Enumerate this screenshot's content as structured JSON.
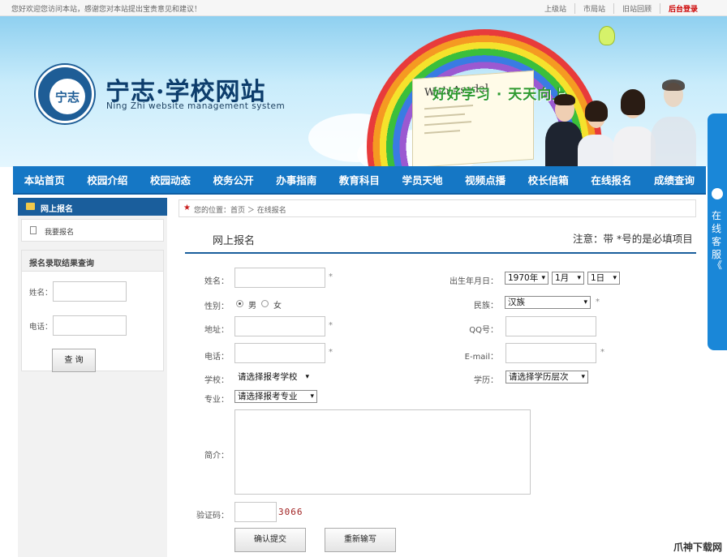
{
  "topbar": {
    "welcome": "您好欢迎您访问本站，感谢您对本站提出宝贵意见和建议！",
    "links": [
      "上级站",
      "市局站",
      "旧站回顾",
      "后台登录"
    ]
  },
  "banner": {
    "logo_text": "宁志",
    "title": "宁志·学校网站",
    "subtitle": "Ning Zhi website management system",
    "slogan": "好好学习 · 天天向上",
    "book_text": "With Asadal"
  },
  "nav": [
    "本站首页",
    "校园介绍",
    "校园动态",
    "校务公开",
    "办事指南",
    "教育科目",
    "学员天地",
    "视频点播",
    "校长信箱",
    "在线报名",
    "成绩查询"
  ],
  "service": {
    "label": "在线客服",
    "chevron": "《"
  },
  "sidebar": {
    "header": "网上报名",
    "item": "我要报名",
    "query_title": "报名录取结果查询",
    "name_label": "姓名：",
    "phone_label": "电话：",
    "query_button": "查 询"
  },
  "breadcrumb": {
    "text": "您的位置：首页 ＞ 在线报名"
  },
  "form": {
    "title": "网上报名",
    "note": "注意：带 *号的是必填项目",
    "required_mark": "*",
    "name_label": "姓名：",
    "birth_label": "出生年月日：",
    "birth_year": "1970年",
    "birth_month": "1月",
    "birth_day": "1日",
    "gender_label": "性别：",
    "gender_male": "男",
    "gender_female": "女",
    "ethnic_label": "民族：",
    "ethnic_value": "汉族",
    "address_label": "地址：",
    "qq_label": "QQ号：",
    "phone_label": "电话：",
    "email_label": "E-mail：",
    "school_label": "学校：",
    "school_value": "请选择报考学校",
    "edu_label": "学历：",
    "edu_value": "请选择学历层次",
    "major_label": "专业：",
    "major_value": "请选择报考专业",
    "intro_label": "简介：",
    "captcha_label": "验证码：",
    "captcha_code": "3066",
    "submit": "确认提交",
    "reset": "重新输写"
  },
  "watermark": "爪神下载网"
}
